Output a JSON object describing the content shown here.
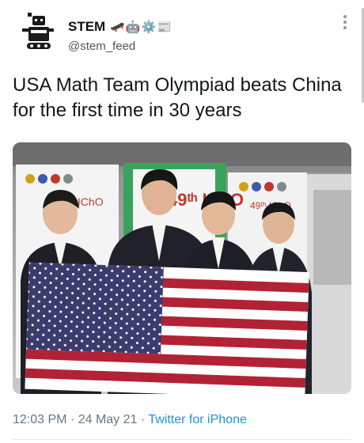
{
  "tweet": {
    "author_name": "STEM",
    "author_emoji": "🛹🤖⚙️📰",
    "handle": "@stem_feed",
    "text": "USA Math Team Olympiad beats China for the first time in 30 years",
    "time": "12:03 PM",
    "separator": " · ",
    "date": "24 May 21",
    "source": "Twitter for iPhone"
  },
  "photo": {
    "banner_text_left": "40ᵗʰ IChO",
    "banner_text_center": "49ᵗʰ IChO",
    "banner_text_right": "49ᵗʰ IChO"
  },
  "colors": {
    "link_blue": "#1b95e0",
    "meta_gray": "#657786",
    "flag_red": "#b22234",
    "flag_blue": "#3c3b6e"
  },
  "icons": [
    "robot-avatar-icon",
    "more-options-icon"
  ]
}
